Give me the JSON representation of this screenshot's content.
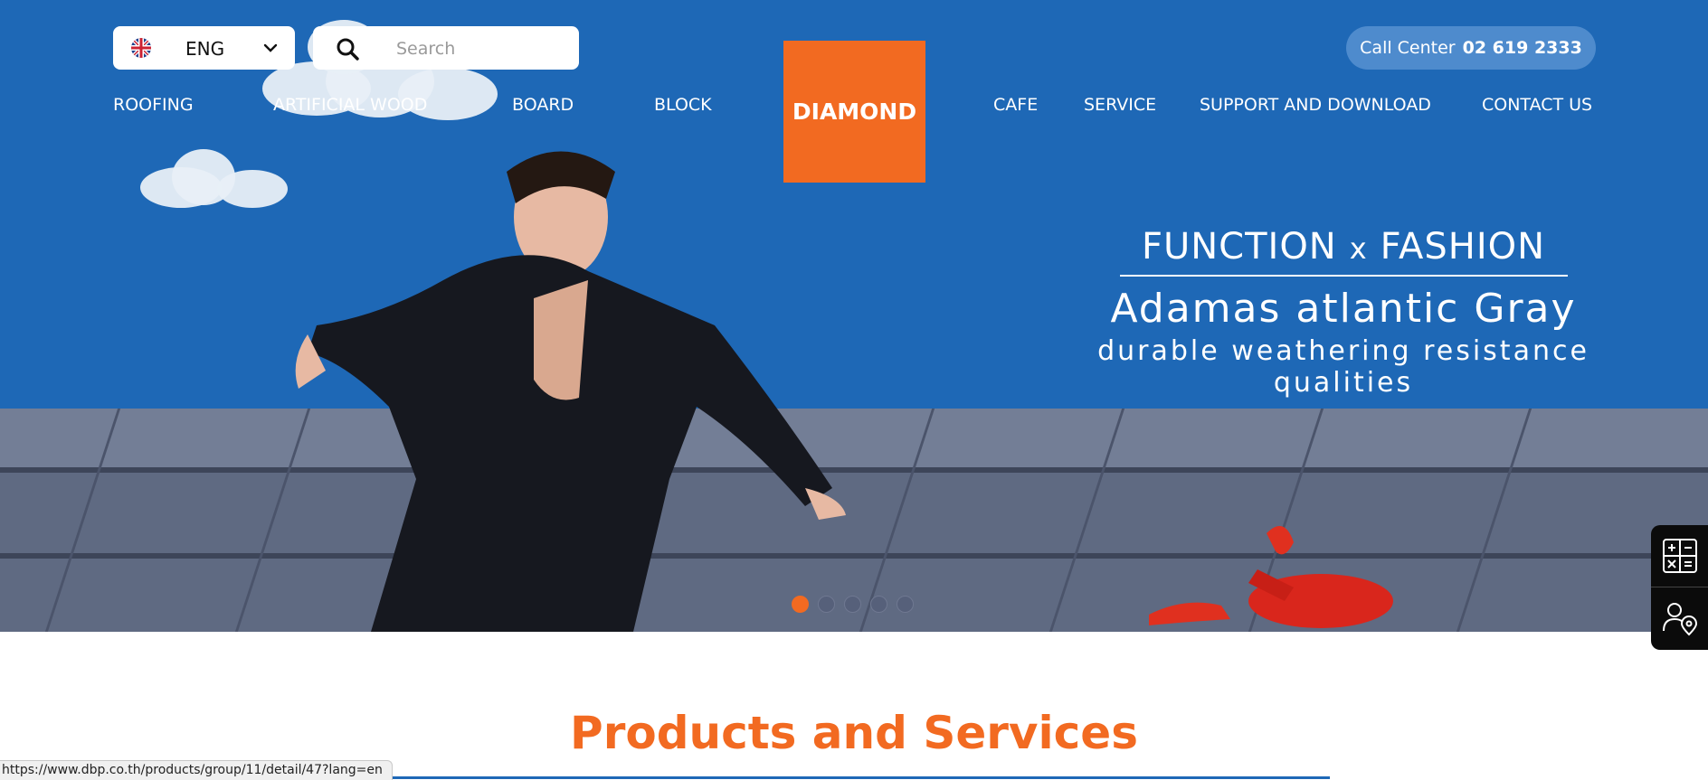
{
  "header": {
    "language": {
      "label": "ENG",
      "flag_icon": "uk-flag-icon"
    },
    "search": {
      "placeholder": "Search"
    },
    "call_center": {
      "label": "Call Center",
      "number": "02 619 2333"
    },
    "logo_text": "DIAMOND"
  },
  "nav": {
    "left": [
      "ROOFING",
      "ARTIFICIAL WOOD",
      "BOARD",
      "BLOCK"
    ],
    "right": [
      "CAFE",
      "SERVICE",
      "SUPPORT AND DOWNLOAD",
      "CONTACT US"
    ]
  },
  "hero": {
    "headline_left": "FUNCTION",
    "headline_x": "x",
    "headline_right": "FASHION",
    "product_name": "Adamas atlantic Gray",
    "tagline": "durable weathering resistance qualities",
    "slides_total": 5,
    "active_slide": 1
  },
  "side_widgets": [
    {
      "icon": "calculator-icon"
    },
    {
      "icon": "user-location-icon"
    }
  ],
  "section": {
    "title": "Products and Services"
  },
  "status_url": "https://www.dbp.co.th/products/group/11/detail/47?lang=en",
  "colors": {
    "brand_orange": "#f26a21",
    "hero_blue": "#1e68b6",
    "call_pill": "#4e8bcd"
  }
}
